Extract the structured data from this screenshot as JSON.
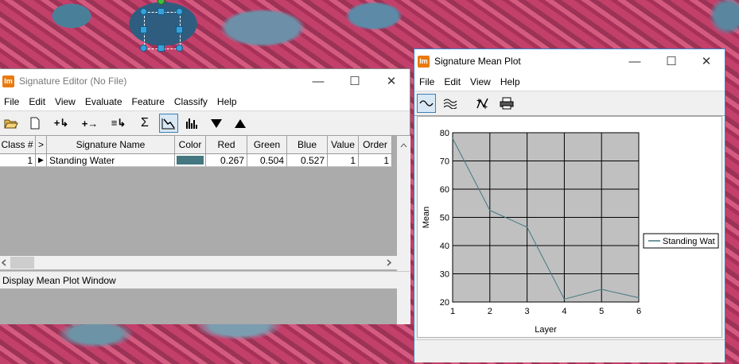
{
  "colors": {
    "accent": "#3d7fc6",
    "app_icon": "#e87a10",
    "class_swatch": "#447780",
    "plot_bg": "#c0c0c0",
    "line": "#447780"
  },
  "sig_editor": {
    "title": "Signature Editor (No File)",
    "menus": [
      "File",
      "Edit",
      "View",
      "Evaluate",
      "Feature",
      "Classify",
      "Help"
    ],
    "toolbar_icons": [
      "open-folder-icon",
      "new-file-icon",
      "add-signature-icon",
      "replace-signature-icon",
      "merge-signature-icon",
      "statistics-sigma-icon",
      "mean-plot-icon",
      "histogram-icon",
      "move-down-icon",
      "move-up-icon"
    ],
    "columns": [
      "Class #",
      ">",
      "Signature Name",
      "Color",
      "Red",
      "Green",
      "Blue",
      "Value",
      "Order"
    ],
    "rows": [
      {
        "class": "1",
        "marker": "▶",
        "name": "Standing Water",
        "color": "#447780",
        "red": "0.267",
        "green": "0.504",
        "blue": "0.527",
        "value": "1",
        "order": "1"
      }
    ],
    "status": "Display Mean Plot Window"
  },
  "mean_plot": {
    "title": "Signature Mean Plot",
    "menus": [
      "File",
      "Edit",
      "View",
      "Help"
    ],
    "toolbar_icons": [
      "single-signature-plot-icon",
      "all-signatures-plot-icon",
      "normalize-icon",
      "print-icon"
    ]
  },
  "chart_data": {
    "type": "line",
    "x": [
      1,
      2,
      3,
      4,
      5,
      6
    ],
    "series": [
      {
        "name": "Standing Wat",
        "values": [
          78,
          52.5,
          46.5,
          21,
          24.5,
          21.5
        ]
      }
    ],
    "xlabel": "Layer",
    "ylabel": "Mean",
    "xlim": [
      1,
      6
    ],
    "ylim": [
      20,
      80
    ],
    "xticks": [
      "1",
      "2",
      "3",
      "4",
      "5",
      "6"
    ],
    "yticks": [
      "20",
      "30",
      "40",
      "50",
      "60",
      "70",
      "80"
    ],
    "grid": true,
    "legend": "right"
  }
}
